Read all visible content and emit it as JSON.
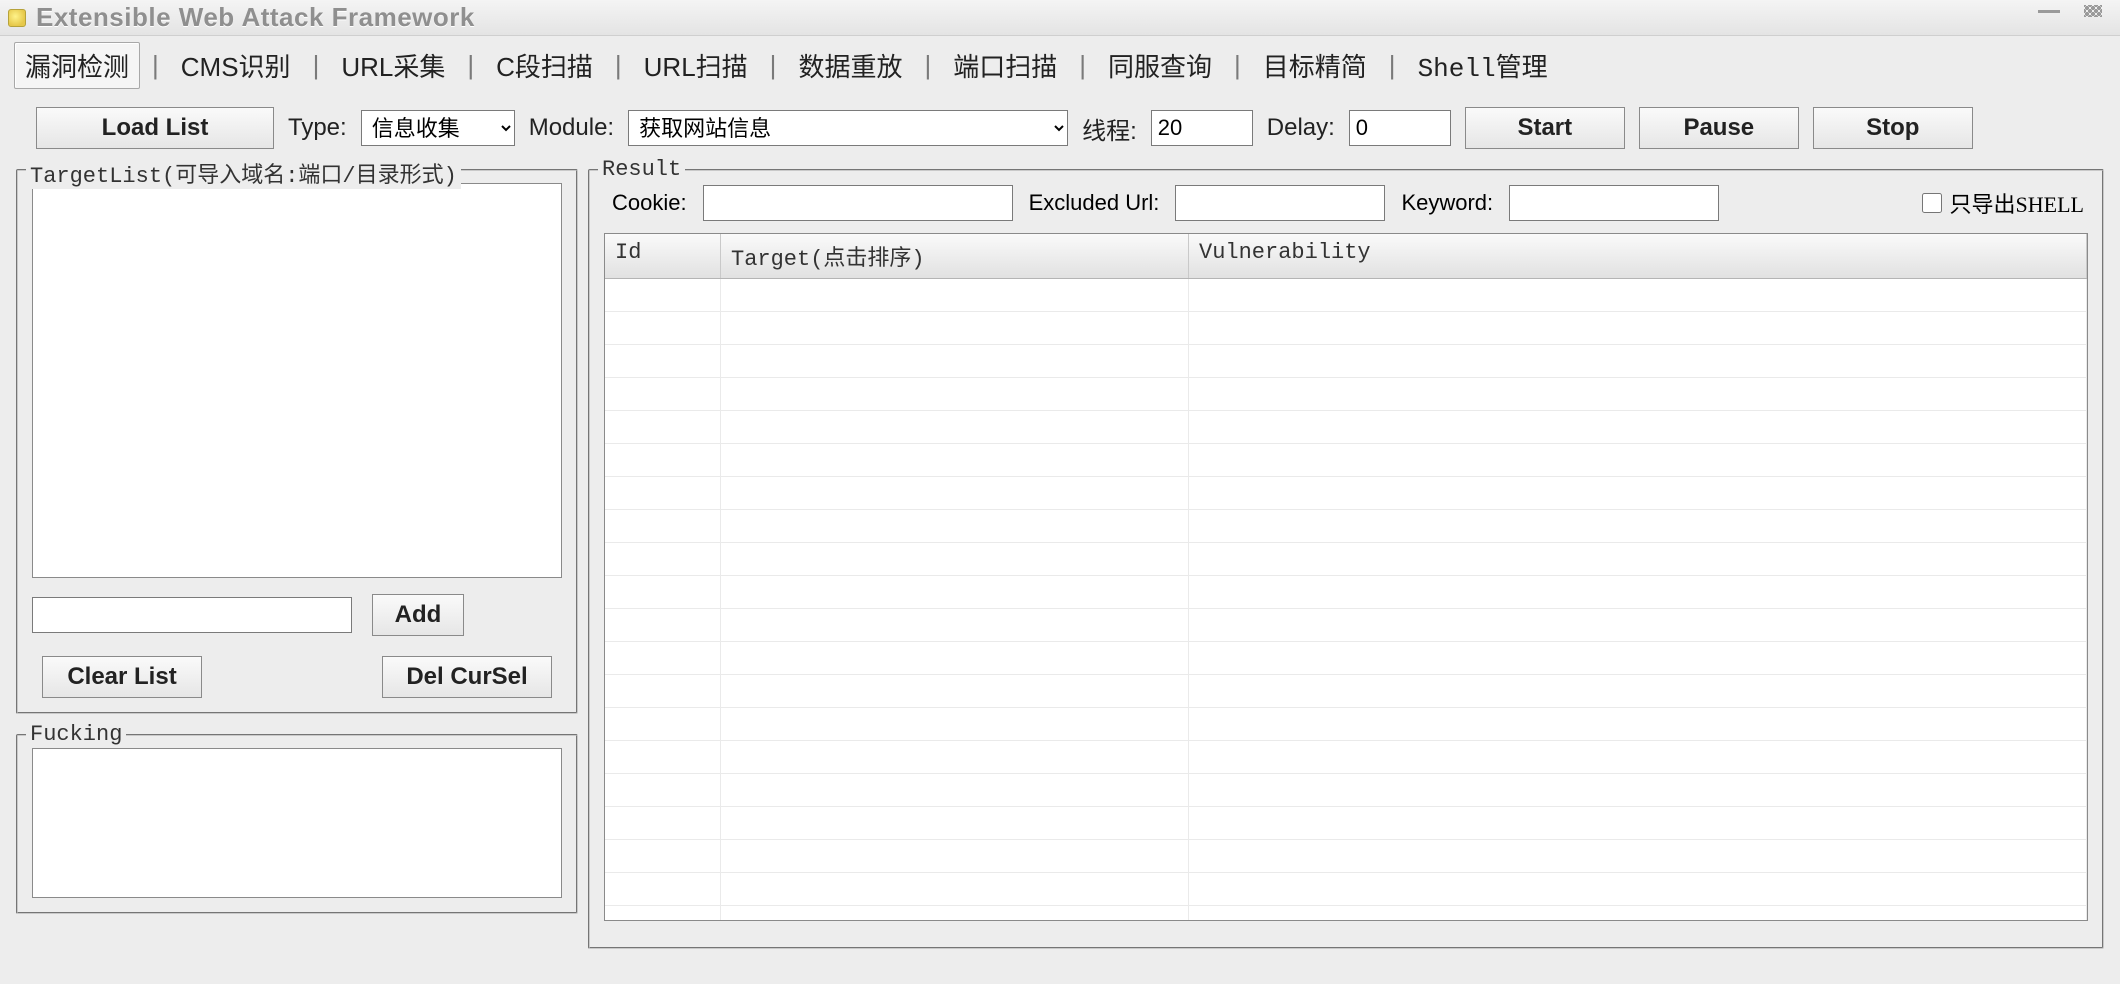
{
  "window": {
    "title": "Extensible Web Attack Framework"
  },
  "tabs": [
    "漏洞检测",
    "CMS识别",
    "URL采集",
    "C段扫描",
    "URL扫描",
    "数据重放",
    "端口扫描",
    "同服查询",
    "目标精简",
    "Shell管理"
  ],
  "active_tab_index": 0,
  "toolbar": {
    "load_list": "Load List",
    "type_label": "Type:",
    "type_value": "信息收集",
    "module_label": "Module:",
    "module_value": "获取网站信息",
    "threads_label": "线程:",
    "threads_value": "20",
    "delay_label": "Delay:",
    "delay_value": "0",
    "start": "Start",
    "pause": "Pause",
    "stop": "Stop"
  },
  "targetlist": {
    "legend": "TargetList(可导入域名:端口/目录形式)",
    "add_value": "",
    "add_btn": "Add",
    "clear_btn": "Clear List",
    "del_btn": "Del CurSel"
  },
  "fucking": {
    "legend": "Fucking"
  },
  "result": {
    "legend": "Result",
    "cookie_label": "Cookie:",
    "cookie_value": "",
    "excl_label": "Excluded Url:",
    "excl_value": "",
    "keyword_label": "Keyword:",
    "keyword_value": "",
    "export_shell_label": "只导出SHELL",
    "columns": {
      "id": "Id",
      "target": "Target(点击排序)",
      "vuln": "Vulnerability"
    },
    "rows": []
  }
}
